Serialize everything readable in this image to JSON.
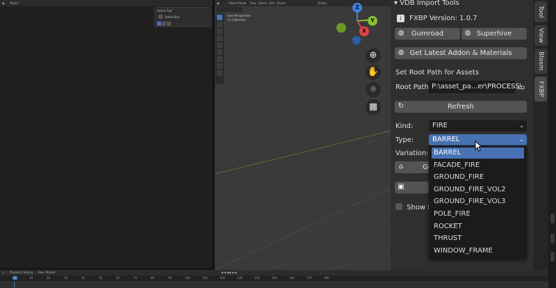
{
  "left_editor": {
    "mode_label": "Object",
    "active_tool_title": "Active Tool",
    "active_tool_item": "Select Box"
  },
  "viewport": {
    "mode_label": "Object Mode",
    "menu": [
      "View",
      "Select",
      "Add",
      "Object"
    ],
    "transform_label": "Global",
    "info_line1": "User Perspective",
    "info_line2": "(1) Collection"
  },
  "gizmo": {
    "z": "Z",
    "y": "Y",
    "x": "X"
  },
  "nav_icons": [
    "zoom-icon",
    "hand-icon",
    "camera-icon",
    "grid-icon"
  ],
  "panel": {
    "title": "VDB Import Tools",
    "version": "FXBP Version: 1.0.7",
    "gumroad": "Gumroad",
    "superhive": "Superhive",
    "get_latest": "Get Latest Addon & Materials",
    "set_root_heading": "Set Root Path for Assets",
    "root_path_label": "Root Path:",
    "root_path_value": "P:\\asset_pa...er\\PROCESS\\",
    "refresh": "Refresh",
    "kind_label": "Kind:",
    "kind_value": "FIRE",
    "type_label": "Type:",
    "type_value": "BARREL",
    "variation_label": "Variation:",
    "ge_button": "Ge",
    "show_label": "Show P"
  },
  "dropdown": {
    "options": [
      "BARREL",
      "FACADE_FIRE",
      "GROUND_FIRE",
      "GROUND_FIRE_VOL2",
      "GROUND_FIRE_VOL3",
      "POLE_FIRE",
      "ROCKET",
      "THRUST",
      "WINDOW_FRAME"
    ],
    "selected": "BARREL"
  },
  "tabs": [
    "Tool",
    "View",
    "Blosm",
    "FXBP"
  ],
  "timeline": {
    "menu": [
      "Playback",
      "Keying",
      "View",
      "Marker"
    ],
    "current_frame": "1",
    "ruler": [
      "1",
      "10",
      "20",
      "30",
      "40",
      "50",
      "60",
      "70",
      "80",
      "90",
      "100",
      "110",
      "120",
      "130",
      "140",
      "150",
      "160",
      "170",
      "180"
    ]
  },
  "colors": {
    "accent": "#4772b3",
    "x_axis": "#e2454a",
    "y_axis": "#8bbf2e",
    "z_axis": "#3d85e0"
  }
}
